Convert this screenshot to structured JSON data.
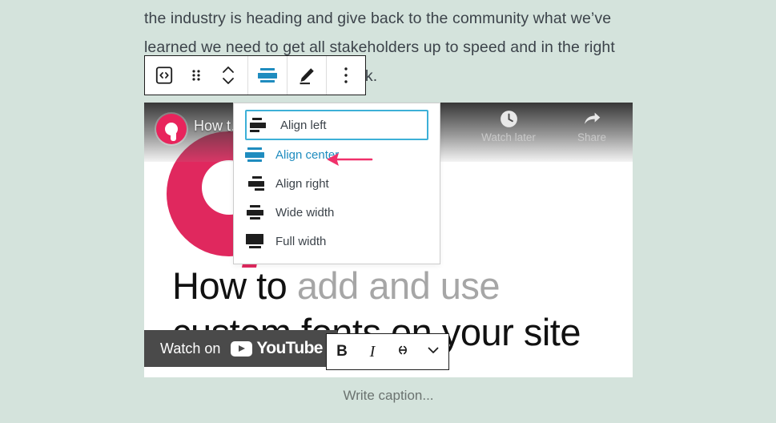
{
  "theme": {
    "page_bg": "#d4e3dc",
    "accent_blue": "#1f8cbf",
    "focus_blue": "#3db0d7",
    "annotation_pink": "#f0306a",
    "brand_pink": "#e8245c"
  },
  "editor": {
    "paragraph_lines": [
      "the industry is heading and give back to the community what we’ve",
      "learned we need to get all stakeholders up to speed and in the right",
      "ck."
    ],
    "caption_placeholder": "Write caption..."
  },
  "block_toolbar": {
    "buttons": [
      {
        "name": "block-type-embed",
        "icon": "code-embed-icon",
        "label": "Embed block"
      },
      {
        "name": "drag-handle",
        "icon": "drag-dots-icon",
        "label": "Drag"
      },
      {
        "name": "move-updown",
        "icon": "chevron-up-down-icon",
        "label": "Move up or down"
      },
      {
        "name": "change-alignment",
        "icon": "align-center-icon",
        "label": "Change alignment"
      },
      {
        "name": "edit-url",
        "icon": "pencil-icon",
        "label": "Edit URL"
      },
      {
        "name": "more-options",
        "icon": "vertical-ellipsis-icon",
        "label": "Options"
      }
    ]
  },
  "align_menu": {
    "items": [
      {
        "label": "Align left",
        "icon": "align-left-icon",
        "state": "focused"
      },
      {
        "label": "Align center",
        "icon": "align-center-icon",
        "state": "selected"
      },
      {
        "label": "Align right",
        "icon": "align-right-icon",
        "state": "normal"
      },
      {
        "label": "Wide width",
        "icon": "wide-width-icon",
        "state": "normal"
      },
      {
        "label": "Full width",
        "icon": "full-width-icon",
        "state": "normal"
      }
    ]
  },
  "video": {
    "overlay_title": "How t…                           ur Wor…",
    "actions": [
      {
        "label": "Watch later",
        "icon": "clock-icon"
      },
      {
        "label": "Share",
        "icon": "share-arrow-icon"
      }
    ],
    "headline_part1": "How to ",
    "headline_part2": "add and use",
    "headline_part3": "custom fonts on your site",
    "watch_on_label": "Watch on",
    "platform_name": "YouTube"
  },
  "format_toolbar": {
    "buttons": [
      {
        "name": "bold-button",
        "label": "B",
        "icon": "bold-icon"
      },
      {
        "name": "italic-button",
        "label": "I",
        "icon": "italic-icon"
      },
      {
        "name": "link-button",
        "label": "",
        "icon": "link-icon"
      },
      {
        "name": "more-rich-text-button",
        "label": "",
        "icon": "chevron-down-icon"
      }
    ]
  }
}
